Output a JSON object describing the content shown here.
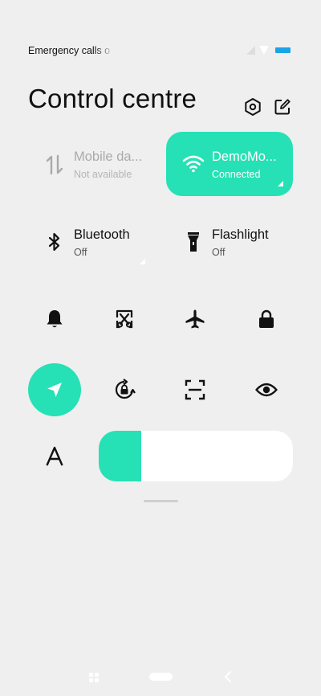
{
  "status_bar": {
    "text": "Emergency calls o"
  },
  "header": {
    "title": "Control centre"
  },
  "tiles": {
    "mobile": {
      "label": "Mobile da...",
      "sub": "Not available"
    },
    "wifi": {
      "label": "DemoMo...",
      "sub": "Connected"
    },
    "bluetooth": {
      "label": "Bluetooth",
      "sub": "Off"
    },
    "flashlight": {
      "label": "Flashlight",
      "sub": "Off"
    }
  },
  "toggles_row1": [
    "bell-icon",
    "screenshot-icon",
    "airplane-icon",
    "lock-icon"
  ],
  "toggles_row2": [
    "location-icon",
    "rotation-lock-icon",
    "scanner-icon",
    "eye-icon"
  ],
  "font_icon_glyph": "A",
  "brightness": {
    "level": 0.22
  },
  "colors": {
    "accent": "#26e1b5",
    "background": "#efefef",
    "battery": "#1aa3e8"
  }
}
